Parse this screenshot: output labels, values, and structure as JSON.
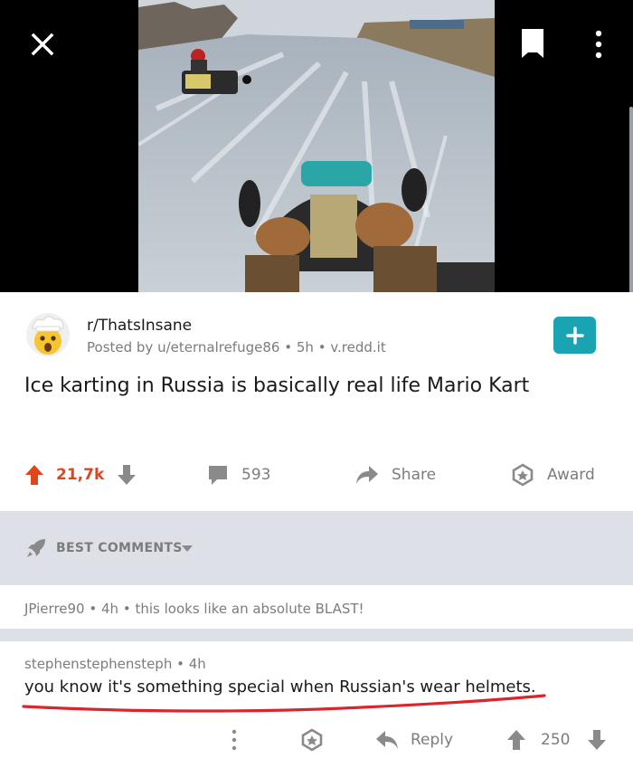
{
  "toolbar": {
    "close_icon": "close-icon",
    "bookmark_icon": "bookmark-icon",
    "more_icon": "more-vertical-icon"
  },
  "post": {
    "subreddit": "r/ThatsInsane",
    "posted_by": "Posted by u/eternalrefuge86",
    "age": "5h",
    "domain": "v.redd.it",
    "title": "Ice karting in Russia is basically real life Mario Kart",
    "upvotes": "21,7k",
    "comments": "593",
    "share_label": "Share",
    "award_label": "Award"
  },
  "sort": {
    "label": "BEST COMMENTS"
  },
  "comments": [
    {
      "author": "JPierre90",
      "age": "4h",
      "text": "this looks like an absolute BLAST!"
    },
    {
      "author": "stephenstephensteph",
      "age": "4h",
      "text": "you know it's something special when Russian's wear helmets.",
      "reply_label": "Reply",
      "score": "250"
    }
  ],
  "colors": {
    "upvote": "#e0461c",
    "join": "#1aa3b3",
    "separator": "#dde1e7",
    "annotation": "#d8262c"
  }
}
